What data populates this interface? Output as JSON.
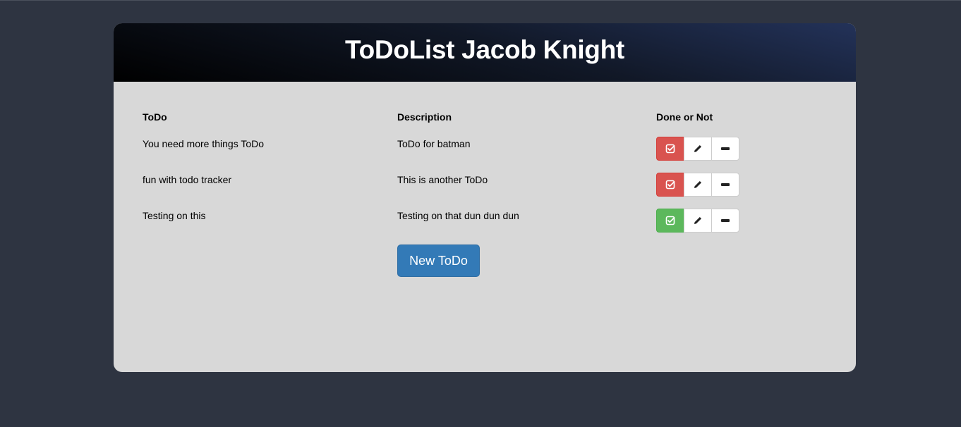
{
  "app": {
    "title": "ToDoList Jacob Knight"
  },
  "table": {
    "headers": [
      "ToDo",
      "Description",
      "Done or Not"
    ],
    "rows": [
      {
        "todo": "You need more things ToDo",
        "description": "ToDo for batman",
        "done": false
      },
      {
        "todo": "fun with todo tracker",
        "description": "This is another ToDo",
        "done": false
      },
      {
        "todo": "Testing on this",
        "description": "Testing on that dun dun dun",
        "done": true
      }
    ]
  },
  "actions": {
    "new_label": "New ToDo",
    "icons": [
      "check-square-icon",
      "pencil-icon",
      "minus-icon"
    ]
  },
  "colors": {
    "page_bg": "#2e3441",
    "panel_bg": "#d8d8d8",
    "not_done": "#d9534f",
    "done": "#5cb85c",
    "primary": "#337ab7"
  }
}
